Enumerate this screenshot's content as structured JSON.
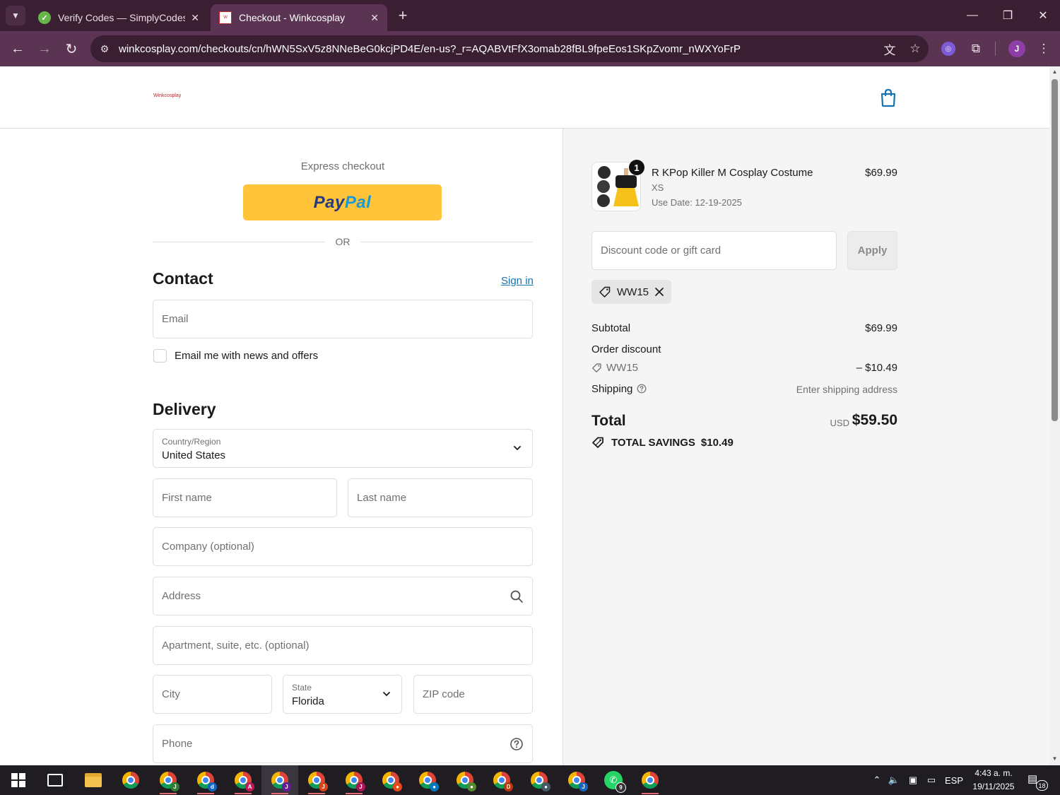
{
  "browser": {
    "tabs": [
      {
        "title": "Verify Codes — SimplyCodes",
        "active": false
      },
      {
        "title": "Checkout - Winkcosplay",
        "active": true
      }
    ],
    "new_tab": "+",
    "url": "winkcosplay.com/checkouts/cn/hWN5SxV5z8NNeBeG0kcjPD4E/en-us?_r=AQABVtFfX3omab28fBL9fpeEos1SKpZvomr_nWXYoFrP",
    "profile_initial": "J"
  },
  "shop": {
    "logo_text": "Winkcosplay"
  },
  "express": {
    "title": "Express checkout",
    "paypal_part1": "Pay",
    "paypal_part2": "Pal",
    "or_text": "OR"
  },
  "contact": {
    "title": "Contact",
    "sign_in": "Sign in",
    "email_placeholder": "Email",
    "newsletter_label": "Email me with news and offers"
  },
  "delivery": {
    "title": "Delivery",
    "country_label": "Country/Region",
    "country_value": "United States",
    "first_name_placeholder": "First name",
    "last_name_placeholder": "Last name",
    "company_placeholder": "Company (optional)",
    "address_placeholder": "Address",
    "apartment_placeholder": "Apartment, suite, etc. (optional)",
    "city_placeholder": "City",
    "state_label": "State",
    "state_value": "Florida",
    "zip_placeholder": "ZIP code",
    "phone_placeholder": "Phone"
  },
  "order": {
    "item": {
      "quantity": "1",
      "name": "R KPop Killer M Cosplay Costume",
      "variant": "XS",
      "use_date": "Use Date: 12-19-2025",
      "price": "$69.99"
    },
    "discount_placeholder": "Discount code or gift card",
    "apply_label": "Apply",
    "applied_code": "WW15",
    "subtotal_label": "Subtotal",
    "subtotal_value": "$69.99",
    "order_discount_label": "Order discount",
    "discount_code": "WW15",
    "discount_value": "– $10.49",
    "shipping_label": "Shipping",
    "shipping_value": "Enter shipping address",
    "total_label": "Total",
    "total_currency": "USD",
    "total_value": "$59.50",
    "savings_label": "TOTAL SAVINGS",
    "savings_value": "$10.49"
  },
  "taskbar": {
    "whatsapp_badge": "9",
    "language": "ESP",
    "time": "4:43 a. m.",
    "date": "19/11/2025",
    "notification_count": "18"
  },
  "colors": {
    "browser_tabbar": "#3a1f33",
    "browser_toolbar": "#5a3452",
    "paypal_yellow": "#ffc439",
    "link_blue": "#1773b0",
    "brand_red": "#b3262d"
  }
}
